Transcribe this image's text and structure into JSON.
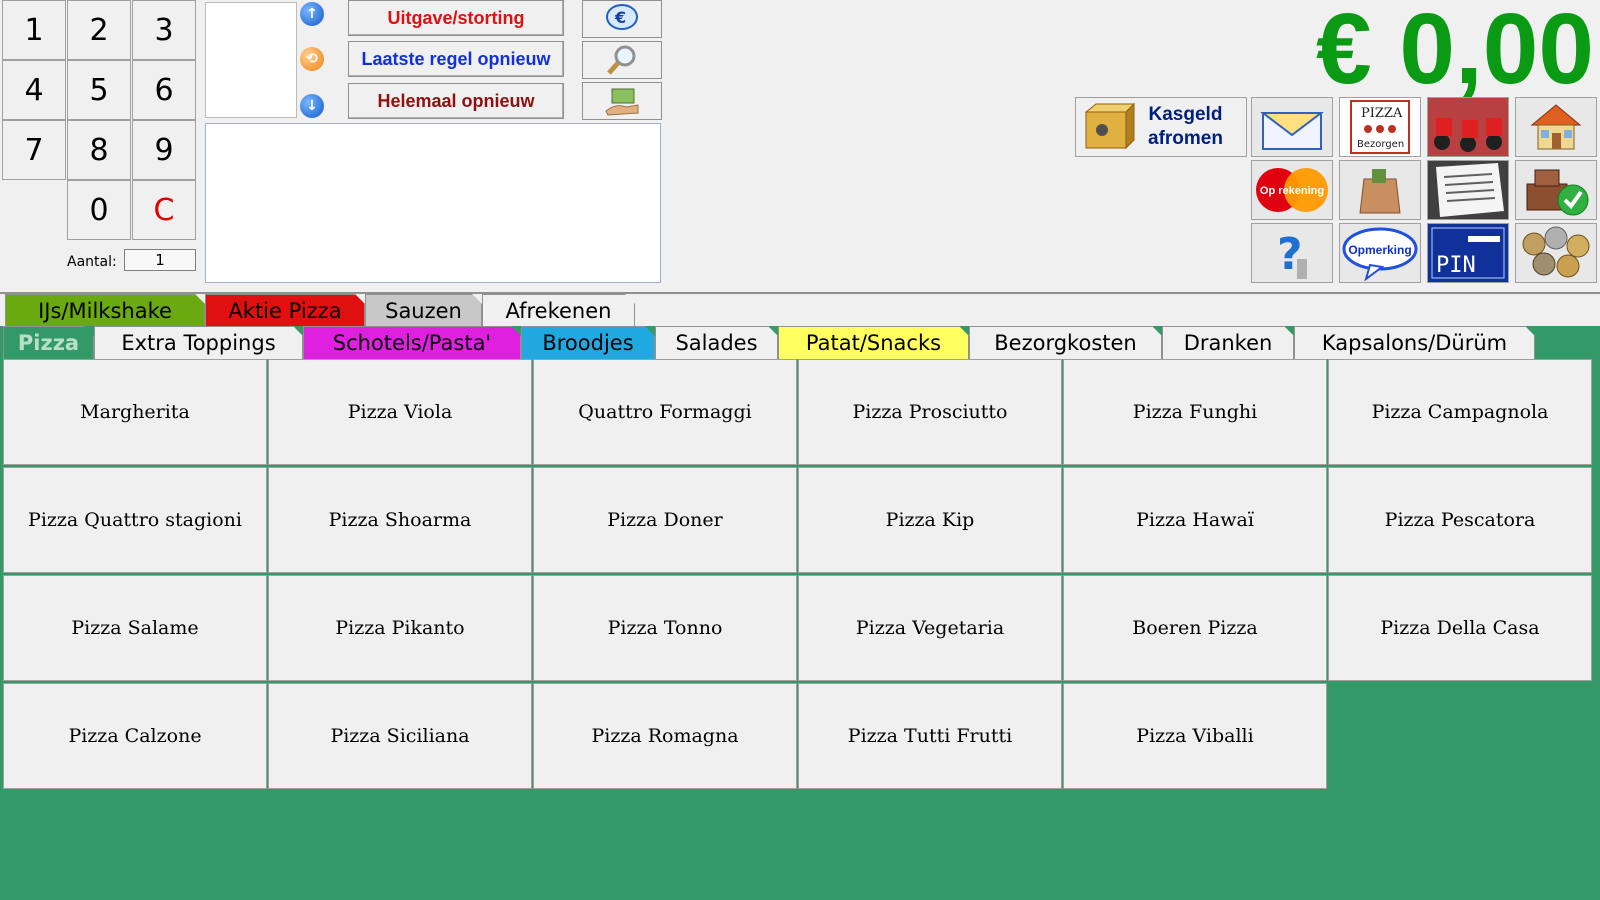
{
  "numpad": {
    "keys": [
      "1",
      "2",
      "3",
      "4",
      "5",
      "6",
      "7",
      "8",
      "9",
      "0",
      "C"
    ],
    "qty_label": "Aantal:",
    "qty_value": "1"
  },
  "actions": {
    "deposit": "Uitgave/storting",
    "redo_last": "Laatste regel opnieuw",
    "reset_all": "Helemaal opnieuw"
  },
  "total": "€ 0,00",
  "quick": {
    "kasgeld_line1": "Kasgeld",
    "kasgeld_line2": "afromen",
    "pizza_label": "PIZZA",
    "bezorgen_label": "Bezorgen",
    "op_rekening": "Op rekening",
    "opmerking": "Opmerking",
    "pin": "PIN"
  },
  "colors": {
    "total": "#0a9a14",
    "panel": "#339966"
  },
  "tabs_row1": [
    {
      "label": "IJs/Milkshake",
      "color": "#6aaa10"
    },
    {
      "label": "Aktie Pizza",
      "color": "#e01010"
    },
    {
      "label": "Sauzen",
      "color": "#c8c8c8"
    },
    {
      "label": "Afrekenen",
      "color": "#f0f0f0"
    }
  ],
  "tabs_row2": [
    {
      "label": "Pizza",
      "color": "#339966",
      "active": true
    },
    {
      "label": "Extra Toppings",
      "color": "#f0f0f0"
    },
    {
      "label": "Schotels/Pasta'",
      "color": "#e020e0"
    },
    {
      "label": "Broodjes",
      "color": "#20a8e0"
    },
    {
      "label": "Salades",
      "color": "#f0f0f0"
    },
    {
      "label": "Patat/Snacks",
      "color": "#ffff60"
    },
    {
      "label": "Bezorgkosten",
      "color": "#f0f0f0"
    },
    {
      "label": "Dranken",
      "color": "#f0f0f0"
    },
    {
      "label": "Kapsalons/Dürüm",
      "color": "#f0f0f0"
    }
  ],
  "products": [
    "Margherita",
    "Pizza Viola",
    "Quattro Formaggi",
    "Pizza Prosciutto",
    "Pizza Funghi",
    "Pizza Campagnola",
    "Pizza Quattro stagioni",
    "Pizza Shoarma",
    "Pizza Doner",
    "Pizza Kip",
    "Pizza Hawaï",
    "Pizza Pescatora",
    "Pizza Salame",
    "Pizza Pikanto",
    "Pizza Tonno",
    "Pizza Vegetaria",
    "Boeren Pizza",
    "Pizza Della Casa",
    "Pizza Calzone",
    "Pizza Siciliana",
    "Pizza Romagna",
    "Pizza Tutti Frutti",
    "Pizza Viballi"
  ]
}
